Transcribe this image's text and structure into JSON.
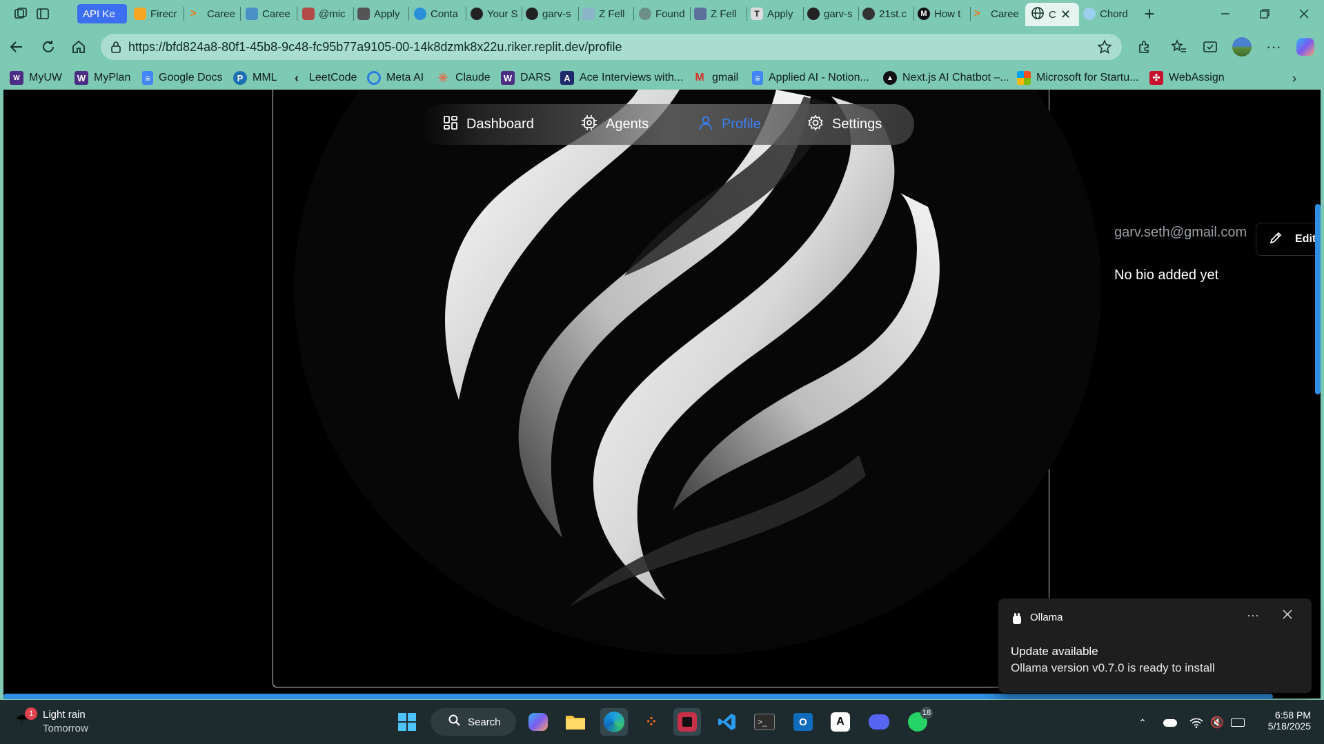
{
  "browser": {
    "tabs": [
      {
        "title": "API Ke"
      },
      {
        "title": "Firecr"
      },
      {
        "title": "Caree"
      },
      {
        "title": "Caree"
      },
      {
        "title": "@mic"
      },
      {
        "title": "Apply"
      },
      {
        "title": "Conta"
      },
      {
        "title": "Your S"
      },
      {
        "title": "garv-s"
      },
      {
        "title": "Z Fell"
      },
      {
        "title": "Found"
      },
      {
        "title": "Z Fell"
      },
      {
        "title": "Apply"
      },
      {
        "title": "garv-s"
      },
      {
        "title": "21st.c"
      },
      {
        "title": "How t"
      },
      {
        "title": "Caree"
      },
      {
        "title": "C"
      },
      {
        "title": "Chord"
      }
    ],
    "url": "https://bfd824a8-80f1-45b8-9c48-fc95b77a9105-00-14k8dzmk8x22u.riker.replit.dev/profile",
    "bookmarks": [
      {
        "label": "MyUW"
      },
      {
        "label": "MyPlan"
      },
      {
        "label": "Google Docs"
      },
      {
        "label": "MML"
      },
      {
        "label": "LeetCode"
      },
      {
        "label": "Meta AI"
      },
      {
        "label": "Claude"
      },
      {
        "label": "DARS"
      },
      {
        "label": "Ace Interviews with..."
      },
      {
        "label": "gmail"
      },
      {
        "label": "Applied AI - Notion..."
      },
      {
        "label": "Next.js AI Chatbot –..."
      },
      {
        "label": "Microsoft for Startu..."
      },
      {
        "label": "WebAssign"
      }
    ]
  },
  "app": {
    "nav": {
      "dashboard": "Dashboard",
      "agents": "Agents",
      "profile": "Profile",
      "settings": "Settings"
    },
    "profile": {
      "email": "garv.seth@gmail.com",
      "edit_label": "Edit",
      "bio": "No bio added yet"
    }
  },
  "notification": {
    "app": "Ollama",
    "title": "Update available",
    "body": "Ollama version v0.7.0 is ready to install"
  },
  "taskbar": {
    "weather_title": "Light rain",
    "weather_sub": "Tomorrow",
    "weather_badge": "1",
    "search_label": "Search",
    "whatsapp_badge": "18",
    "time": "6:58 PM",
    "date": "5/18/2025"
  },
  "colors": {
    "browser_frame": "#7ec9b4",
    "accent_blue": "#3b82f6",
    "page_bg": "#000000"
  }
}
